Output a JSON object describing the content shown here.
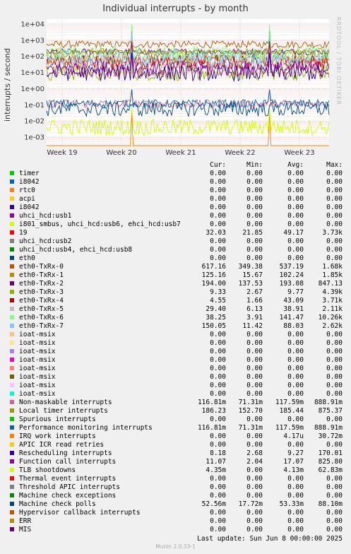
{
  "chart_data": {
    "type": "line",
    "title": "Individual interrupts - by month",
    "ylabel": "interrupts / second",
    "side_label": "RRDTOOL / TOBI OETIKER",
    "y_scale": "log",
    "ylim": [
      0.0003,
      20000
    ],
    "y_ticks": [
      {
        "value": 10000,
        "label": "1e+04"
      },
      {
        "value": 1000,
        "label": "1e+03"
      },
      {
        "value": 100,
        "label": "1e+02"
      },
      {
        "value": 10,
        "label": "1e+01"
      },
      {
        "value": 1,
        "label": "1e+00"
      },
      {
        "value": 0.1,
        "label": "1e-01"
      },
      {
        "value": 0.01,
        "label": "1e-02"
      },
      {
        "value": 0.001,
        "label": "1e-03"
      }
    ],
    "x_ticks": [
      "Week 19",
      "Week 20",
      "Week 21",
      "Week 22",
      "Week 23"
    ],
    "grid": true,
    "columns": [
      "Cur:",
      "Min:",
      "Avg:",
      "Max:"
    ],
    "series": [
      {
        "name": "timer",
        "color": "#00cc00",
        "cur": "0.00",
        "min": "0.00",
        "avg": "0.00",
        "max": "0.00"
      },
      {
        "name": "i8042",
        "color": "#0066b3",
        "cur": "0.00",
        "min": "0.00",
        "avg": "0.00",
        "max": "0.00"
      },
      {
        "name": "rtc0",
        "color": "#ff8000",
        "cur": "0.00",
        "min": "0.00",
        "avg": "0.00",
        "max": "0.00"
      },
      {
        "name": "acpi",
        "color": "#ffcc00",
        "cur": "0.00",
        "min": "0.00",
        "avg": "0.00",
        "max": "0.00"
      },
      {
        "name": "i8042",
        "color": "#330099",
        "cur": "0.00",
        "min": "0.00",
        "avg": "0.00",
        "max": "0.00"
      },
      {
        "name": "uhci_hcd:usb1",
        "color": "#990099",
        "cur": "0.00",
        "min": "0.00",
        "avg": "0.00",
        "max": "0.00"
      },
      {
        "name": "i801_smbus, uhci_hcd:usb6, ehci_hcd:usb7",
        "color": "#ccff00",
        "cur": "0.00",
        "min": "0.00",
        "avg": "0.00",
        "max": "0.00"
      },
      {
        "name": "19",
        "color": "#ff0000",
        "cur": "32.03",
        "min": "21.85",
        "avg": "49.17",
        "max": "3.73k"
      },
      {
        "name": "uhci_hcd:usb2",
        "color": "#808080",
        "cur": "0.00",
        "min": "0.00",
        "avg": "0.00",
        "max": "0.00"
      },
      {
        "name": "uhci_hcd:usb4, ehci_hcd:usb8",
        "color": "#008f00",
        "cur": "0.00",
        "min": "0.00",
        "avg": "0.00",
        "max": "0.00"
      },
      {
        "name": "eth0",
        "color": "#00487d",
        "cur": "0.00",
        "min": "0.00",
        "avg": "0.00",
        "max": "0.00"
      },
      {
        "name": "eth0-TxRx-0",
        "color": "#b35a00",
        "cur": "617.16",
        "min": "349.38",
        "avg": "537.19",
        "max": "1.68k"
      },
      {
        "name": "eth0-TxRx-1",
        "color": "#b38f00",
        "cur": "125.16",
        "min": "15.67",
        "avg": "102.24",
        "max": "1.85k"
      },
      {
        "name": "eth0-TxRx-2",
        "color": "#6b006b",
        "cur": "194.00",
        "min": "137.53",
        "avg": "193.08",
        "max": "847.13"
      },
      {
        "name": "eth0-TxRx-3",
        "color": "#8fb300",
        "cur": "9.33",
        "min": "2.67",
        "avg": "9.77",
        "max": "4.39k"
      },
      {
        "name": "eth0-TxRx-4",
        "color": "#b30000",
        "cur": "4.55",
        "min": "1.66",
        "avg": "43.09",
        "max": "3.71k"
      },
      {
        "name": "eth0-TxRx-5",
        "color": "#bebebe",
        "cur": "29.40",
        "min": "6.13",
        "avg": "38.91",
        "max": "2.11k"
      },
      {
        "name": "eth0-TxRx-6",
        "color": "#80ff80",
        "cur": "38.25",
        "min": "3.91",
        "avg": "141.47",
        "max": "10.26k"
      },
      {
        "name": "eth0-TxRx-7",
        "color": "#80c9ff",
        "cur": "150.05",
        "min": "11.42",
        "avg": "88.03",
        "max": "2.62k"
      },
      {
        "name": "ioat-msix",
        "color": "#ffc080",
        "cur": "0.00",
        "min": "0.00",
        "avg": "0.00",
        "max": "0.00"
      },
      {
        "name": "ioat-msix",
        "color": "#ffe680",
        "cur": "0.00",
        "min": "0.00",
        "avg": "0.00",
        "max": "0.00"
      },
      {
        "name": "ioat-msix",
        "color": "#aa80ff",
        "cur": "0.00",
        "min": "0.00",
        "avg": "0.00",
        "max": "0.00"
      },
      {
        "name": "ioat-msix",
        "color": "#ee00cc",
        "cur": "0.00",
        "min": "0.00",
        "avg": "0.00",
        "max": "0.00"
      },
      {
        "name": "ioat-msix",
        "color": "#ff8080",
        "cur": "0.00",
        "min": "0.00",
        "avg": "0.00",
        "max": "0.00"
      },
      {
        "name": "ioat-msix",
        "color": "#666600",
        "cur": "0.00",
        "min": "0.00",
        "avg": "0.00",
        "max": "0.00"
      },
      {
        "name": "ioat-msix",
        "color": "#ffbfff",
        "cur": "0.00",
        "min": "0.00",
        "avg": "0.00",
        "max": "0.00"
      },
      {
        "name": "ioat-msix",
        "color": "#00ffcc",
        "cur": "0.00",
        "min": "0.00",
        "avg": "0.00",
        "max": "0.00"
      },
      {
        "name": "Non-maskable interrupts",
        "color": "#cc6699",
        "cur": "116.81m",
        "min": "71.31m",
        "avg": "117.59m",
        "max": "888.91m"
      },
      {
        "name": "Local timer interrupts",
        "color": "#999900",
        "cur": "186.23",
        "min": "152.70",
        "avg": "185.44",
        "max": "875.37"
      },
      {
        "name": "Spurious interrupts",
        "color": "#00cc00",
        "cur": "0.00",
        "min": "0.00",
        "avg": "0.00",
        "max": "0.00"
      },
      {
        "name": "Performance monitoring interrupts",
        "color": "#0066b3",
        "cur": "116.81m",
        "min": "71.31m",
        "avg": "117.59m",
        "max": "888.91m"
      },
      {
        "name": "IRQ work interrupts",
        "color": "#ff8000",
        "cur": "0.00",
        "min": "0.00",
        "avg": "4.17u",
        "max": "30.72m"
      },
      {
        "name": "APIC ICR read retries",
        "color": "#ffcc00",
        "cur": "0.00",
        "min": "0.00",
        "avg": "0.00",
        "max": "0.00"
      },
      {
        "name": "Rescheduling interrupts",
        "color": "#330099",
        "cur": "8.18",
        "min": "2.68",
        "avg": "9.27",
        "max": "170.01"
      },
      {
        "name": "Function call interrupts",
        "color": "#990099",
        "cur": "11.07",
        "min": "2.04",
        "avg": "17.07",
        "max": "825.80"
      },
      {
        "name": "TLB shootdowns",
        "color": "#ccff00",
        "cur": "4.35m",
        "min": "0.00",
        "avg": "4.13m",
        "max": "62.83m"
      },
      {
        "name": "Thermal event interrupts",
        "color": "#ff0000",
        "cur": "0.00",
        "min": "0.00",
        "avg": "0.00",
        "max": "0.00"
      },
      {
        "name": "Threshold APIC interrupts",
        "color": "#808080",
        "cur": "0.00",
        "min": "0.00",
        "avg": "0.00",
        "max": "0.00"
      },
      {
        "name": "Machine check exceptions",
        "color": "#008f00",
        "cur": "0.00",
        "min": "0.00",
        "avg": "0.00",
        "max": "0.00"
      },
      {
        "name": "Machine check polls",
        "color": "#00487d",
        "cur": "52.56m",
        "min": "17.72m",
        "avg": "53.33m",
        "max": "88.10m"
      },
      {
        "name": "Hypervisor callback interrupts",
        "color": "#b35a00",
        "cur": "0.00",
        "min": "0.00",
        "avg": "0.00",
        "max": "0.00"
      },
      {
        "name": "ERR",
        "color": "#b38f00",
        "cur": "0.00",
        "min": "0.00",
        "avg": "0.00",
        "max": "0.00"
      },
      {
        "name": "MIS",
        "color": "#6b006b",
        "cur": "0.00",
        "min": "0.00",
        "avg": "0.00",
        "max": "0.00"
      }
    ]
  },
  "footer": {
    "last_update": "Last update:  Sun Jun  8 00:00:00 2025",
    "version": "Munin 2.0.33-1"
  }
}
